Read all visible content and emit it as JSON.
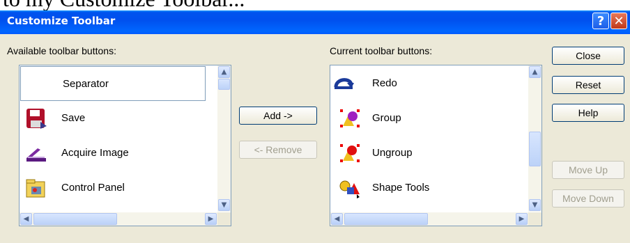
{
  "background_fragment": "to my Customize Toolbar...",
  "dialog": {
    "title": "Customize Toolbar",
    "help_glyph": "?",
    "close_glyph": "✕"
  },
  "available": {
    "label": "Available toolbar buttons:",
    "items": [
      {
        "label": "Separator",
        "icon": "none",
        "selected": true
      },
      {
        "label": "Save",
        "icon": "save-icon"
      },
      {
        "label": "Acquire Image",
        "icon": "scanner-icon"
      },
      {
        "label": "Control Panel",
        "icon": "control-panel-icon"
      }
    ]
  },
  "current": {
    "label": "Current toolbar buttons:",
    "items": [
      {
        "label": "Redo",
        "icon": "redo-icon"
      },
      {
        "label": "Group",
        "icon": "group-icon"
      },
      {
        "label": "Ungroup",
        "icon": "ungroup-icon"
      },
      {
        "label": "Shape Tools",
        "icon": "shape-tools-icon"
      }
    ]
  },
  "buttons": {
    "add": "Add ->",
    "remove": "<- Remove",
    "close": "Close",
    "reset": "Reset",
    "help": "Help",
    "move_up": "Move Up",
    "move_down": "Move Down"
  },
  "colors": {
    "titlebar": "#0054e3",
    "dialog_bg": "#ece9d8",
    "listbox_border": "#7f9db9",
    "disabled_text": "#a19f8f"
  }
}
